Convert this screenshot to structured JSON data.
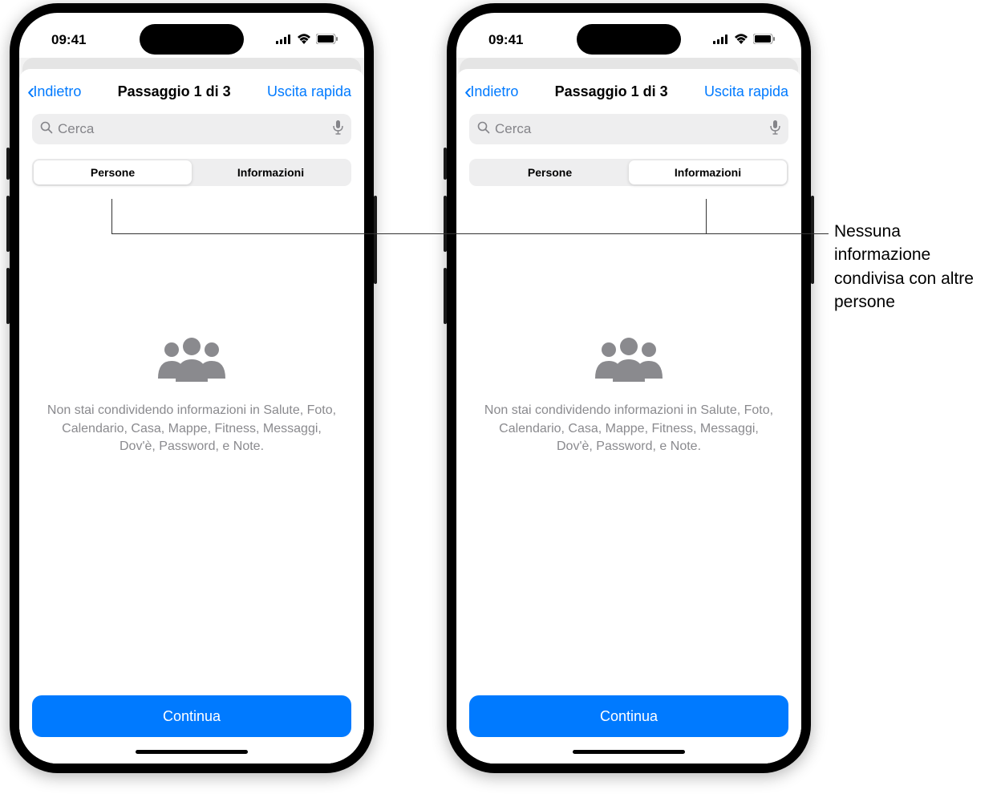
{
  "status": {
    "time": "09:41"
  },
  "nav": {
    "back_label": "Indietro",
    "title": "Passaggio 1 di 3",
    "exit_label": "Uscita rapida"
  },
  "search": {
    "placeholder": "Cerca"
  },
  "tabs": {
    "persone": "Persone",
    "informazioni": "Informazioni"
  },
  "empty_state": {
    "text": "Non stai condividendo informazioni in Salute, Foto, Calendario, Casa, Mappe, Fitness, Messaggi, Dov'è, Password, e Note."
  },
  "continue_label": "Continua",
  "callout": {
    "text": "Nessuna informazione condivisa con altre persone"
  }
}
